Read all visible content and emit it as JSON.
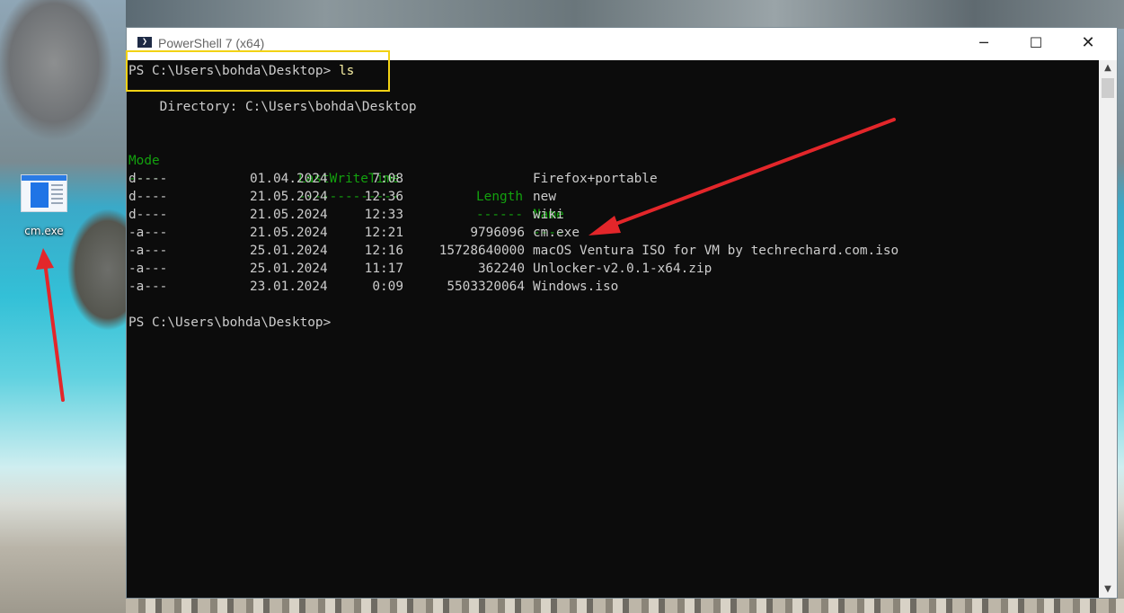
{
  "desktop": {
    "icon_label": "cm.exe",
    "icon_name": "exe-file-icon"
  },
  "window": {
    "title": "PowerShell 7 (x64)",
    "controls": {
      "minimize": "─",
      "maximize": "☐",
      "close": "✕"
    }
  },
  "console": {
    "prompt1": "PS C:\\Users\\bohda\\Desktop> ",
    "command": "ls",
    "directory_line": "    Directory: C:\\Users\\bohda\\Desktop",
    "headers": {
      "mode": "Mode",
      "time": "LastWriteTime",
      "length": "Length",
      "name": "Name"
    },
    "dashes": {
      "mode": "----",
      "time": "-------------",
      "length": "------",
      "name": "----"
    },
    "rows": [
      {
        "mode": "d----",
        "date": "01.04.2024",
        "time": "7:08",
        "length": "",
        "name": "Firefox+portable"
      },
      {
        "mode": "d----",
        "date": "21.05.2024",
        "time": "12:36",
        "length": "",
        "name": "new"
      },
      {
        "mode": "d----",
        "date": "21.05.2024",
        "time": "12:33",
        "length": "",
        "name": "wiki"
      },
      {
        "mode": "-a---",
        "date": "21.05.2024",
        "time": "12:21",
        "length": "9796096",
        "name": "cm.exe"
      },
      {
        "mode": "-a---",
        "date": "25.01.2024",
        "time": "12:16",
        "length": "15728640000",
        "name": "macOS Ventura ISO for VM by techrechard.com.iso"
      },
      {
        "mode": "-a---",
        "date": "25.01.2024",
        "time": "11:17",
        "length": "362240",
        "name": "Unlocker-v2.0.1-x64.zip"
      },
      {
        "mode": "-a---",
        "date": "23.01.2024",
        "time": "0:09",
        "length": "5503320064",
        "name": "Windows.iso"
      }
    ],
    "prompt2": "PS C:\\Users\\bohda\\Desktop>"
  },
  "colors": {
    "terminal_bg": "#0c0c0c",
    "terminal_fg": "#cccccc",
    "header_green": "#13a10e",
    "command_yellow": "#f9f1a5",
    "annotation_yellow": "#f2d214",
    "annotation_red": "#e3262a"
  },
  "scrollbar": {
    "up": "▲",
    "down": "▼"
  }
}
